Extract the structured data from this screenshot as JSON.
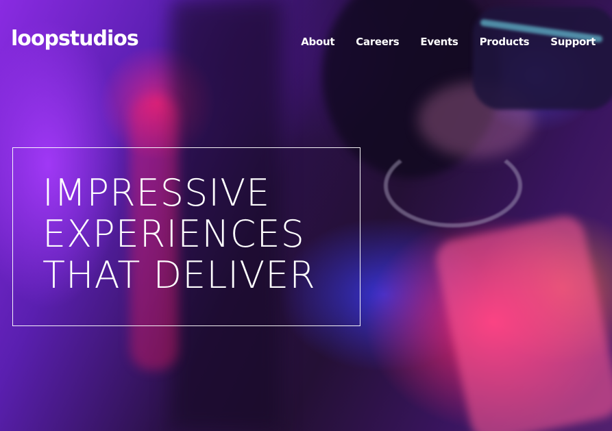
{
  "brand": {
    "logo_text": "loopstudios"
  },
  "nav": {
    "items": [
      {
        "label": "About"
      },
      {
        "label": "Careers"
      },
      {
        "label": "Events"
      },
      {
        "label": "Products"
      },
      {
        "label": "Support"
      }
    ]
  },
  "hero": {
    "headline_lines": [
      "IMPRESSIVE",
      "EXPERIENCES",
      "THAT DELIVER"
    ],
    "text_color": "#ffffff"
  }
}
